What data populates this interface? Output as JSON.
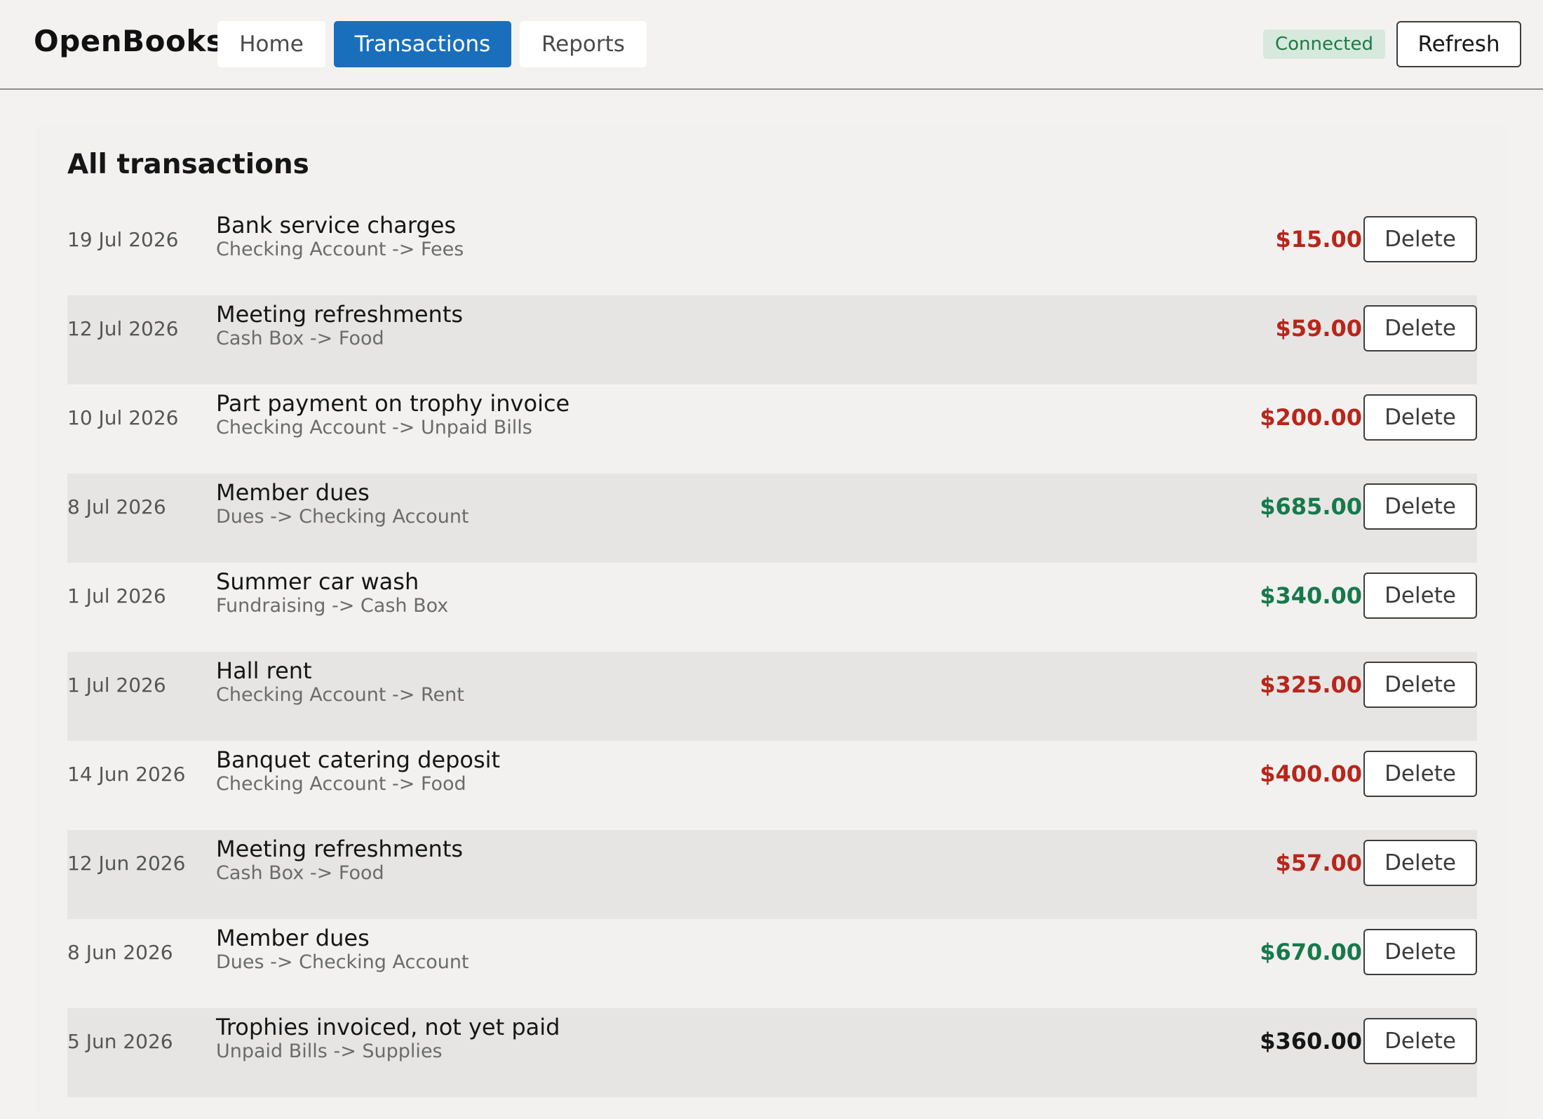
{
  "header": {
    "brand": "OpenBooks",
    "tabs": [
      {
        "label": "Home",
        "active": false
      },
      {
        "label": "Transactions",
        "active": true
      },
      {
        "label": "Reports",
        "active": false
      }
    ],
    "status": "Connected",
    "refresh_label": "Refresh"
  },
  "main": {
    "title": "All transactions",
    "delete_label": "Delete",
    "transactions": [
      {
        "date": "19 Jul 2026",
        "description": "Bank service charges",
        "route": "Checking Account -> Fees",
        "amount": "$15.00",
        "kind": "expense"
      },
      {
        "date": "12 Jul 2026",
        "description": "Meeting refreshments",
        "route": "Cash Box -> Food",
        "amount": "$59.00",
        "kind": "expense"
      },
      {
        "date": "10 Jul 2026",
        "description": "Part payment on trophy invoice",
        "route": "Checking Account -> Unpaid Bills",
        "amount": "$200.00",
        "kind": "expense"
      },
      {
        "date": "8 Jul 2026",
        "description": "Member dues",
        "route": "Dues -> Checking Account",
        "amount": "$685.00",
        "kind": "income"
      },
      {
        "date": "1 Jul 2026",
        "description": "Summer car wash",
        "route": "Fundraising -> Cash Box",
        "amount": "$340.00",
        "kind": "income"
      },
      {
        "date": "1 Jul 2026",
        "description": "Hall rent",
        "route": "Checking Account -> Rent",
        "amount": "$325.00",
        "kind": "expense"
      },
      {
        "date": "14 Jun 2026",
        "description": "Banquet catering deposit",
        "route": "Checking Account -> Food",
        "amount": "$400.00",
        "kind": "expense"
      },
      {
        "date": "12 Jun 2026",
        "description": "Meeting refreshments",
        "route": "Cash Box -> Food",
        "amount": "$57.00",
        "kind": "expense"
      },
      {
        "date": "8 Jun 2026",
        "description": "Member dues",
        "route": "Dues -> Checking Account",
        "amount": "$670.00",
        "kind": "income"
      },
      {
        "date": "5 Jun 2026",
        "description": "Trophies invoiced, not yet paid",
        "route": "Unpaid Bills -> Supplies",
        "amount": "$360.00",
        "kind": "transfer"
      }
    ]
  },
  "colors": {
    "accent": "#1a6fbd",
    "expense": "#b8261a",
    "income": "#17794a",
    "transfer": "#161616",
    "status_bg": "#d7e8dc",
    "status_text": "#1f7a45"
  }
}
